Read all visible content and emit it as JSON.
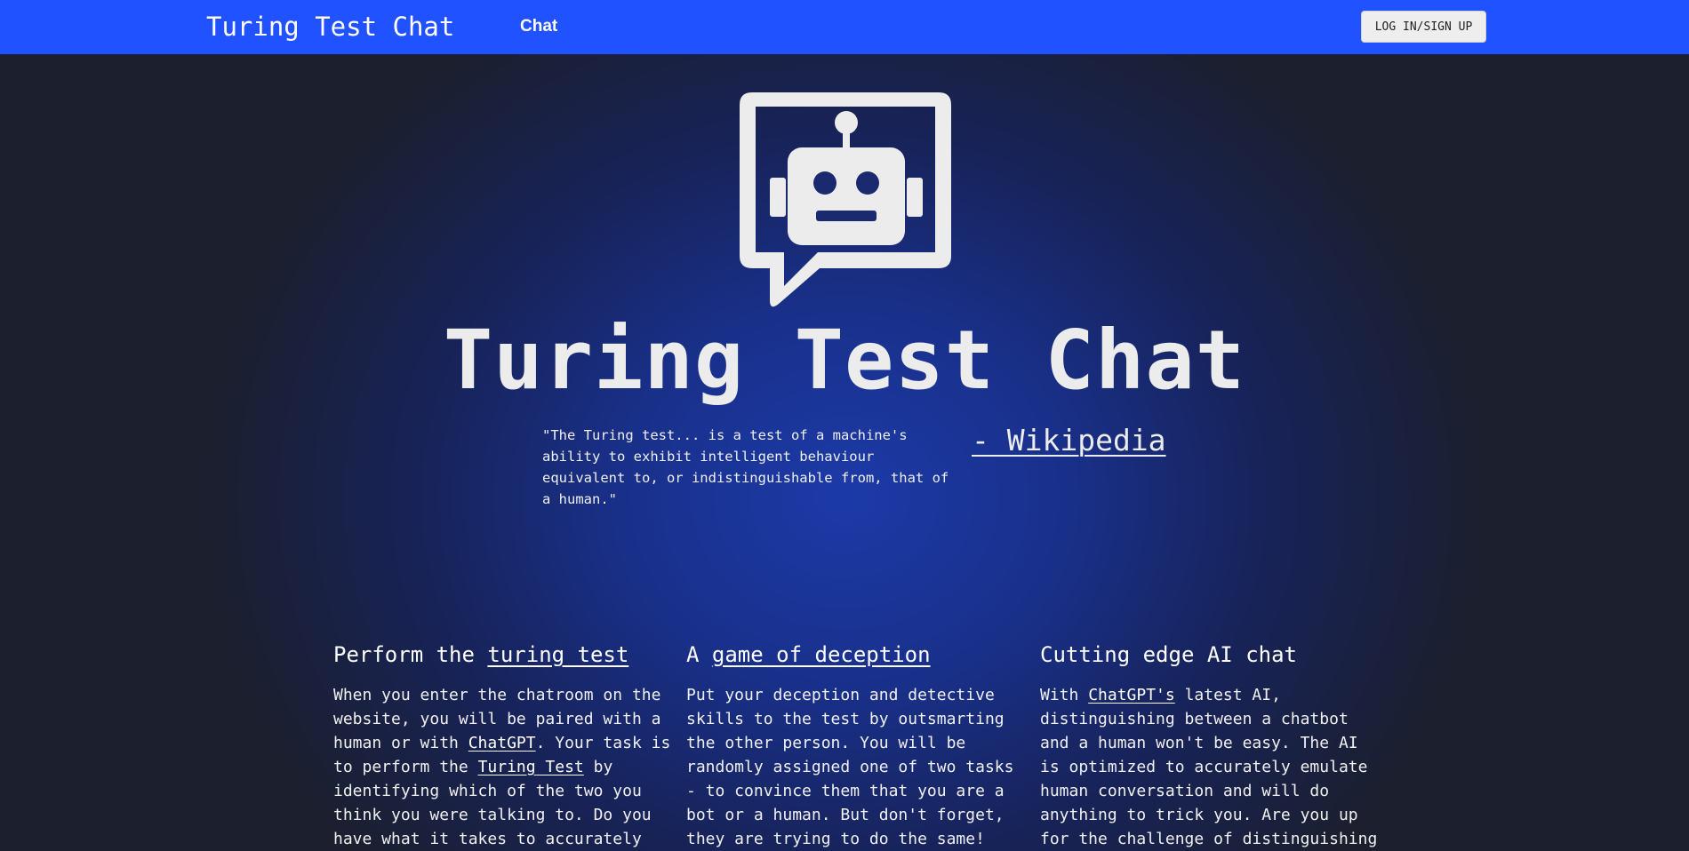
{
  "navbar": {
    "brand": "Turing Test Chat",
    "links": [
      "Chat"
    ],
    "login_label": "LOG IN/SIGN UP",
    "background": "#2152ff"
  },
  "hero": {
    "logo_icon": "robot-chat-bubble-icon",
    "title": "Turing Test Chat",
    "quote": "\"The Turing test... is a test of a machine's ability to exhibit intelligent behaviour equivalent to, or indistinguishable from, that of a human.\"",
    "quote_source": "- Wikipedia"
  },
  "features": [
    {
      "title_prefix": "Perform the ",
      "title_link": "turing test",
      "body": [
        {
          "t": "When you enter the chatroom on the website, you will be paired with a human or with "
        },
        {
          "t": "ChatGPT",
          "link": true
        },
        {
          "t": ". Your task is to perform the "
        },
        {
          "t": "Turing Test",
          "link": true
        },
        {
          "t": " by identifying which of the two you think you were talking to. Do you have what it takes to accurately"
        }
      ]
    },
    {
      "title_prefix": "A ",
      "title_link": "game of deception",
      "body": [
        {
          "t": "Put your deception and detective skills to the test by outsmarting the other person. You will be randomly assigned one of two tasks - to convince them that you are a bot or a human. But don't forget, they are trying to do the same!"
        }
      ]
    },
    {
      "title_prefix": "Cutting edge AI chat",
      "title_link": "",
      "body": [
        {
          "t": "With "
        },
        {
          "t": "ChatGPT's",
          "link": true
        },
        {
          "t": " latest AI, distinguishing between a chatbot and a human won't be easy. The AI is optimized to accurately emulate human conversation and will do anything to trick you. Are you up for the challenge of distinguishing"
        }
      ]
    }
  ]
}
